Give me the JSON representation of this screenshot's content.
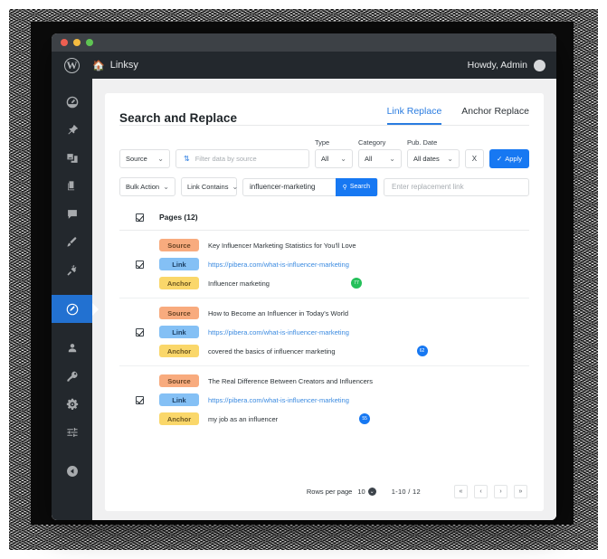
{
  "window": {
    "traffic_lights": [
      "red",
      "yellow",
      "green"
    ]
  },
  "adminbar": {
    "wp_logo": "wordpress-logo-icon",
    "home_icon": "home-icon",
    "site_name": "Linksy",
    "greeting": "Howdy, Admin",
    "avatar": "avatar-icon"
  },
  "sidebar": {
    "items": [
      {
        "name": "dashboard",
        "icon": "dashboard-icon",
        "active": false
      },
      {
        "name": "posts",
        "icon": "pin-icon",
        "active": false
      },
      {
        "name": "media",
        "icon": "media-icon",
        "active": false
      },
      {
        "name": "pages",
        "icon": "pages-icon",
        "active": false
      },
      {
        "name": "comments",
        "icon": "comment-icon",
        "active": false
      },
      {
        "name": "appearance",
        "icon": "brush-icon",
        "active": false
      },
      {
        "name": "plugins",
        "icon": "plug-icon",
        "active": false
      },
      {
        "name": "linksy",
        "icon": "edit-icon",
        "active": true
      },
      {
        "name": "users",
        "icon": "user-icon",
        "active": false
      },
      {
        "name": "tools",
        "icon": "key-icon",
        "active": false
      },
      {
        "name": "settings",
        "icon": "gear-icon",
        "active": false
      },
      {
        "name": "sliders",
        "icon": "sliders-icon",
        "active": false
      },
      {
        "name": "collapse",
        "icon": "collapse-icon",
        "active": false
      }
    ]
  },
  "page": {
    "title": "Search and Replace",
    "tabs": [
      {
        "label": "Link Replace",
        "active": true
      },
      {
        "label": "Anchor Replace",
        "active": false
      }
    ]
  },
  "filters": {
    "source_select": "Source",
    "sort_icon": "sort-icon",
    "filter_placeholder": "Filter data by source",
    "type_label": "Type",
    "type_value": "All",
    "category_label": "Category",
    "category_value": "All",
    "date_label": "Pub. Date",
    "date_value": "All dates",
    "clear_label": "X",
    "apply_label": "Apply",
    "apply_icon": "check-icon",
    "accent_color": "#1778f2"
  },
  "actions": {
    "bulk_action": "Bulk Action",
    "link_contains": "Link Contains",
    "search_term": "influencer-marketing",
    "search_label": "Search",
    "search_icon": "search-icon",
    "replacement_placeholder": "Enter replacement link"
  },
  "table": {
    "select_all_checked": true,
    "header_label": "Pages (12)",
    "tag_labels": {
      "source": "Source",
      "link": "Link",
      "anchor": "Anchor"
    },
    "tag_colors": {
      "source": "#f8ab7e",
      "link": "#84c0f5",
      "anchor": "#fad76a"
    },
    "rows": [
      {
        "checked": true,
        "source": "Key Influencer Marketing Statistics for You'll Love",
        "link": "https://pibera.com/what-is-influencer-marketing",
        "anchor": "Influencer marketing",
        "score": "77",
        "score_color": "green"
      },
      {
        "checked": true,
        "source": "How to Become an Influencer in Today's World",
        "link": "https://pibera.com/what-is-influencer-marketing",
        "anchor": "covered the basics of influencer marketing",
        "score": "62",
        "score_color": "blue"
      },
      {
        "checked": true,
        "source": "The Real Difference Between Creators and Influencers",
        "link": "https://pibera.com/what-is-influencer-marketing",
        "anchor": "my job as an influencer",
        "score": "55",
        "score_color": "blue"
      }
    ]
  },
  "pagination": {
    "rows_per_page_label": "Rows per page",
    "rows_per_page_value": "10",
    "range": "1-10  /  12",
    "first_label": "«",
    "prev_label": "‹",
    "next_label": "›",
    "last_label": "»"
  }
}
